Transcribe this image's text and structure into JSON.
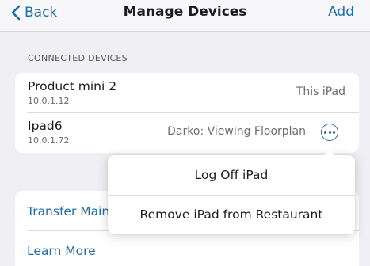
{
  "nav": {
    "back_label": "Back",
    "title": "Manage Devices",
    "add_label": "Add"
  },
  "connected_devices": {
    "header": "CONNECTED DEVICES",
    "devices": [
      {
        "name": "Product mini 2",
        "ip": "10.0.1.12",
        "status": "This iPad",
        "has_more_button": false
      },
      {
        "name": "Ipad6",
        "ip": "10.0.1.72",
        "status": "Darko: Viewing Floorplan",
        "has_more_button": true
      }
    ]
  },
  "links": [
    {
      "label": "Transfer Main"
    },
    {
      "label": "Learn More"
    }
  ],
  "popover_menu": {
    "items": [
      {
        "label": "Log Off iPad"
      },
      {
        "label": "Remove iPad from Restaurant"
      }
    ]
  },
  "colors": {
    "accent": "#1a6fa5",
    "background": "#efeff4",
    "card": "#ffffff"
  },
  "icons": {
    "back": "chevron-left-icon",
    "more": "more-horizontal-circle-icon"
  }
}
